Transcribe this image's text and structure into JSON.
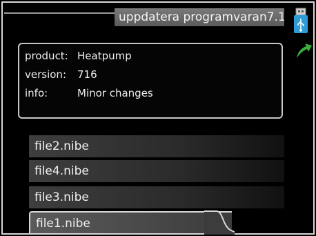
{
  "header": {
    "title": "uppdatera programvaran7.1"
  },
  "icons": {
    "usb": "usb-drive-icon",
    "back": "back-arrow-icon",
    "accent": "#2f9bd6",
    "back_color": "#3cae3c"
  },
  "info": {
    "rows": [
      {
        "key": "product:",
        "value": "Heatpump"
      },
      {
        "key": "version:",
        "value": "716"
      },
      {
        "key": "info:",
        "value": "Minor changes"
      }
    ]
  },
  "files": [
    {
      "name": "file2.nibe",
      "selected": false
    },
    {
      "name": "file4.nibe",
      "selected": false
    },
    {
      "name": "file3.nibe",
      "selected": false
    },
    {
      "name": "file1.nibe",
      "selected": true
    }
  ]
}
